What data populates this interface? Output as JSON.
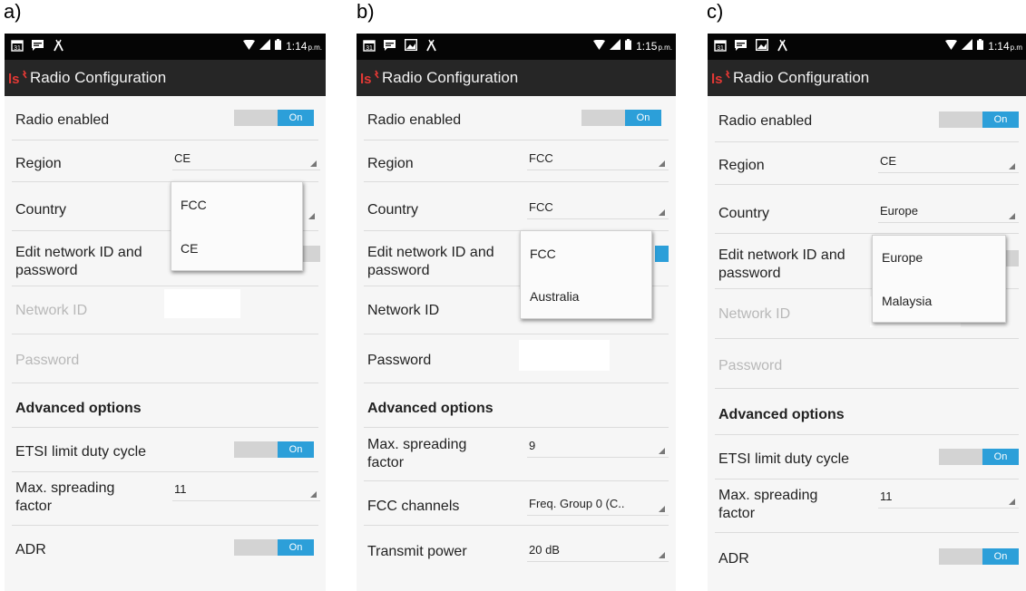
{
  "panels": [
    {
      "letter": "a)",
      "status": {
        "time": "1:14",
        "suffix": "p.m."
      },
      "app_title": "Radio Configuration",
      "rows": {
        "radio_enabled": {
          "label": "Radio enabled",
          "toggle": "On"
        },
        "region": {
          "label": "Region",
          "value": "CE"
        },
        "country": {
          "label": "Country"
        },
        "edit_network": {
          "label": "Edit network ID and password"
        },
        "network_id": {
          "label": "Network ID"
        },
        "password": {
          "label": "Password"
        },
        "advanced": {
          "label": "Advanced options"
        },
        "etsi": {
          "label": "ETSI limit duty cycle",
          "toggle": "On"
        },
        "spreading": {
          "label": "Max. spreading factor",
          "value": "11"
        },
        "adr": {
          "label": "ADR",
          "toggle": "On"
        }
      },
      "dropdown": {
        "options": [
          "FCC",
          "CE"
        ]
      }
    },
    {
      "letter": "b)",
      "status": {
        "time": "1:15",
        "suffix": "p.m."
      },
      "app_title": "Radio Configuration",
      "rows": {
        "radio_enabled": {
          "label": "Radio enabled",
          "toggle": "On"
        },
        "region": {
          "label": "Region",
          "value": "FCC"
        },
        "country": {
          "label": "Country",
          "value": "FCC"
        },
        "edit_network": {
          "label": "Edit network ID and password"
        },
        "network_id": {
          "label": "Network ID"
        },
        "password": {
          "label": "Password"
        },
        "advanced": {
          "label": "Advanced options"
        },
        "spreading": {
          "label": "Max. spreading factor",
          "value": "9"
        },
        "fcc_channels": {
          "label": "FCC channels",
          "value": "Freq. Group 0 (C.."
        },
        "transmit_power": {
          "label": "Transmit power",
          "value": "20 dB"
        }
      },
      "dropdown": {
        "options": [
          "FCC",
          "Australia"
        ]
      }
    },
    {
      "letter": "c)",
      "status": {
        "time": "1:14",
        "suffix": "p.m"
      },
      "app_title": "Radio Configuration",
      "rows": {
        "radio_enabled": {
          "label": "Radio enabled",
          "toggle": "On"
        },
        "region": {
          "label": "Region",
          "value": "CE"
        },
        "country": {
          "label": "Country",
          "value": "Europe"
        },
        "edit_network": {
          "label": "Edit network ID and password"
        },
        "network_id": {
          "label": "Network ID"
        },
        "password": {
          "label": "Password"
        },
        "advanced": {
          "label": "Advanced options"
        },
        "etsi": {
          "label": "ETSI limit duty cycle",
          "toggle": "On"
        },
        "spreading": {
          "label": "Max. spreading factor",
          "value": "11"
        },
        "adr": {
          "label": "ADR",
          "toggle": "On"
        }
      },
      "dropdown": {
        "options": [
          "Europe",
          "Malaysia"
        ]
      }
    }
  ],
  "icons": [
    "calendar-icon",
    "message-icon",
    "image-icon",
    "android-icon",
    "wifi-icon",
    "signal-icon",
    "battery-icon",
    "app-logo-icon"
  ],
  "colors": {
    "toggle_on": "#2c9fd9",
    "appbar": "#262626",
    "statusbar": "#050505"
  }
}
